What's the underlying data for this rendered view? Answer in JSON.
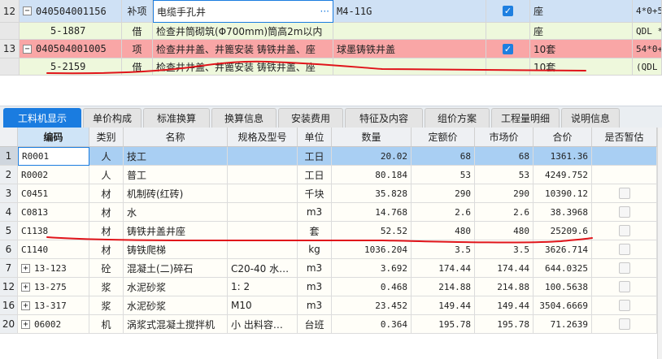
{
  "top_rows": [
    {
      "rownum": "12",
      "expander": "−",
      "code": "040504001156",
      "type": "补项",
      "name": "电缆手孔井",
      "name_more": "···",
      "spec": "M4-11G",
      "checked": true,
      "unit": "座",
      "calc": "4*0+5"
    },
    {
      "rownum": "",
      "expander": "",
      "code": "5-1887",
      "type": "借",
      "name": "检查井筒砌筑(Φ700mm)筒高2m以内",
      "name_more": "",
      "spec": "",
      "checked": false,
      "unit": "座",
      "calc": "QDL *"
    },
    {
      "rownum": "13",
      "expander": "−",
      "code": "040504001005",
      "type": "项",
      "name": "检查井井盖、井篦安装 铸铁井盖、座",
      "name_more": "",
      "spec": "球墨铸铁井盖",
      "checked": true,
      "unit": "10套",
      "calc": "54*0+"
    },
    {
      "rownum": "",
      "expander": "",
      "code": "5-2159",
      "type": "借",
      "name": "检查井井盖、井篦安装 铸铁井盖、座",
      "name_more": "",
      "spec": "",
      "checked": false,
      "unit": "10套",
      "calc": "(QDL +"
    }
  ],
  "tabs": [
    "工料机显示",
    "单价构成",
    "标准换算",
    "换算信息",
    "安装费用",
    "特征及内容",
    "组价方案",
    "工程量明细",
    "说明信息"
  ],
  "columns": [
    "编码",
    "类别",
    "名称",
    "规格及型号",
    "单位",
    "数量",
    "定额价",
    "市场价",
    "合价",
    "是否暂估"
  ],
  "rows": [
    {
      "idx": "1",
      "expand": "",
      "code": "R0001",
      "cat": "人",
      "name": "技工",
      "spec": "",
      "unit": "工日",
      "qty": "20.02",
      "quota": "68",
      "market": "68",
      "total": "1361.36",
      "est": false
    },
    {
      "idx": "2",
      "expand": "",
      "code": "R0002",
      "cat": "人",
      "name": "普工",
      "spec": "",
      "unit": "工日",
      "qty": "80.184",
      "quota": "53",
      "market": "53",
      "total": "4249.752",
      "est": false
    },
    {
      "idx": "3",
      "expand": "",
      "code": "C0451",
      "cat": "材",
      "name": "机制砖(红砖)",
      "spec": "",
      "unit": "千块",
      "qty": "35.828",
      "quota": "290",
      "market": "290",
      "total": "10390.12",
      "est": true
    },
    {
      "idx": "4",
      "expand": "",
      "code": "C0813",
      "cat": "材",
      "name": "水",
      "spec": "",
      "unit": "m3",
      "qty": "14.768",
      "quota": "2.6",
      "market": "2.6",
      "total": "38.3968",
      "est": true
    },
    {
      "idx": "5",
      "expand": "",
      "code": "C1138",
      "cat": "材",
      "name": "铸铁井盖井座",
      "spec": "",
      "unit": "套",
      "qty": "52.52",
      "quota": "480",
      "market": "480",
      "total": "25209.6",
      "est": true
    },
    {
      "idx": "6",
      "expand": "",
      "code": "C1140",
      "cat": "材",
      "name": "铸铁爬梯",
      "spec": "",
      "unit": "kg",
      "qty": "1036.204",
      "quota": "3.5",
      "market": "3.5",
      "total": "3626.714",
      "est": true
    },
    {
      "idx": "7",
      "expand": "+",
      "code": "13-123",
      "cat": "砼",
      "name": "混凝土(二)碎石",
      "spec": "C20-40 水…",
      "unit": "m3",
      "qty": "3.692",
      "quota": "174.44",
      "market": "174.44",
      "total": "644.0325",
      "est": true
    },
    {
      "idx": "12",
      "expand": "+",
      "code": "13-275",
      "cat": "浆",
      "name": "水泥砂浆",
      "spec": "1: 2",
      "unit": "m3",
      "qty": "0.468",
      "quota": "214.88",
      "market": "214.88",
      "total": "100.5638",
      "est": true
    },
    {
      "idx": "16",
      "expand": "+",
      "code": "13-317",
      "cat": "浆",
      "name": "水泥砂浆",
      "spec": "M10",
      "unit": "m3",
      "qty": "23.452",
      "quota": "149.44",
      "market": "149.44",
      "total": "3504.6669",
      "est": true
    },
    {
      "idx": "20",
      "expand": "+",
      "code": "06002",
      "cat": "机",
      "name": "涡浆式混凝土搅拌机",
      "spec": "小 出料容…",
      "unit": "台班",
      "qty": "0.364",
      "quota": "195.78",
      "market": "195.78",
      "total": "71.2639",
      "est": true
    }
  ],
  "colors": {
    "accent": "#1a7ce0",
    "pink_row": "#f9a6a6",
    "green_row": "#eef8dc",
    "selected_row": "#a9cff3",
    "annotation": "#e0141a"
  }
}
